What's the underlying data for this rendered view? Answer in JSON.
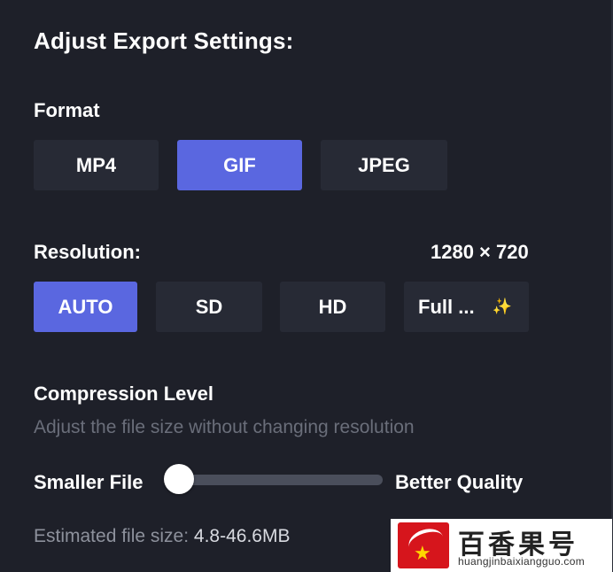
{
  "title": "Adjust Export Settings:",
  "format": {
    "label": "Format",
    "options": [
      "MP4",
      "GIF",
      "JPEG"
    ],
    "selected": "GIF"
  },
  "resolution": {
    "label": "Resolution:",
    "value": "1280 × 720",
    "options": [
      "AUTO",
      "SD",
      "HD",
      "Full ..."
    ],
    "selected": "AUTO",
    "premium_icon": "sparkles-icon",
    "premium_glyph": "✨"
  },
  "compression": {
    "label": "Compression Level",
    "description": "Adjust the file size without changing resolution",
    "min_label": "Smaller File",
    "max_label": "Better Quality",
    "level": 0.0
  },
  "estimate": {
    "label": "Estimated file size:",
    "value": "4.8-46.6MB"
  },
  "watermark": {
    "text_cn": "百香果号",
    "url": "huangjinbaixiangguo.com"
  },
  "colors": {
    "background": "#1e2029",
    "button": "#272a35",
    "accent": "#5a67e0",
    "muted_text": "#6a6e7a"
  }
}
